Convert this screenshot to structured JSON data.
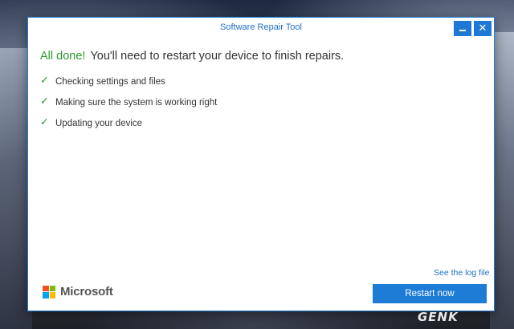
{
  "window": {
    "title": "Software Repair Tool",
    "minimize_icon": "minimize-icon",
    "close_icon": "close-icon",
    "close_glyph": "✕"
  },
  "headline": {
    "status": "All done!",
    "message": "You'll need to restart your device to finish repairs."
  },
  "steps": [
    {
      "label": "Checking settings and files",
      "icon": "check-icon",
      "glyph": "✓"
    },
    {
      "label": "Making sure the system is working right",
      "icon": "check-icon",
      "glyph": "✓"
    },
    {
      "label": "Updating your device",
      "icon": "check-icon",
      "glyph": "✓"
    }
  ],
  "footer": {
    "log_link": "See the log file",
    "brand": "Microsoft",
    "restart_button": "Restart now"
  },
  "watermark": "GENK",
  "colors": {
    "accent": "#1e7bd6",
    "success": "#2e9a2e"
  }
}
